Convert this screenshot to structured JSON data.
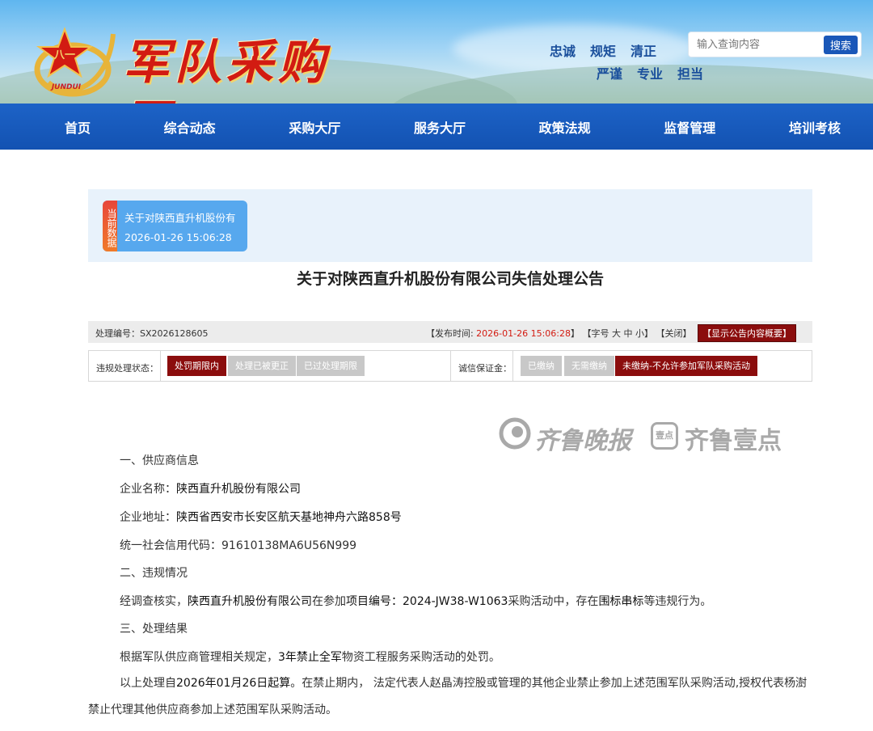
{
  "header": {
    "site_name": "军队采购网",
    "emblem_text": "八一",
    "emblem_sub": "JUNDUI",
    "slogans_row1": [
      "忠诚",
      "规矩",
      "清正"
    ],
    "slogans_row2": [
      "严谨",
      "专业",
      "担当"
    ],
    "search": {
      "placeholder": "输入查询内容",
      "button": "搜索"
    }
  },
  "nav": [
    "首页",
    "综合动态",
    "采购大厅",
    "服务大厅",
    "政策法规",
    "监督管理",
    "培训考核"
  ],
  "current": {
    "tag": "当前数据",
    "title": "关于对陕西直升机股份有",
    "time": "2026-01-26 15:06:28"
  },
  "notice_title": "关于对陕西直升机股份有限公司失信处理公告",
  "meta": {
    "number_label": "处理编号：",
    "number": "SX2026128605",
    "publish_prefix": "【发布时间: ",
    "publish_date": "2026-01-26 15:06:28",
    "publish_suffix": "】",
    "font_prefix": "【字号",
    "font_large": "大",
    "font_medium": "中",
    "font_small": "小",
    "font_suffix": "】",
    "close": "【关闭】",
    "summary": "【显示公告内容概要】"
  },
  "status": {
    "label": "违规处理状态：",
    "options": [
      "处罚期限内",
      "处理已被更正",
      "已过处理期限"
    ],
    "active_index": 0,
    "deposit_label": "诚信保证金：",
    "deposit_options": [
      "已缴纳",
      "无需缴纳",
      "未缴纳-不允许参加军队采购活动"
    ],
    "deposit_active_index": 2
  },
  "watermark": {
    "brand1": "齐鲁晚报",
    "badge": "壹点",
    "brand2": "齐鲁壹点"
  },
  "content": {
    "sec1": "一、供应商信息",
    "name_label": "企业名称：",
    "name": "陕西直升机股份有限公司",
    "addr_label": "企业地址：",
    "addr": "陕西省西安市长安区航天基地神舟六路858号",
    "credit_label": "统一社会信用代码：",
    "credit": "91610138MA6U56N999",
    "sec2": "二、违规情况",
    "v_pre": "经调查核实，",
    "v_company": "陕西直升机股份有限公司",
    "v_mid1": "在参加",
    "v_proj_label": "项目编号：",
    "v_proj": "2024-JW38-W1063",
    "v_mid2": "采购活动中，存在",
    "v_kind": "围标串标",
    "v_end": "等违规行为。",
    "sec3": "三、处理结果",
    "r_pre": "根据军队供应商管理相关规定，",
    "r_years": "3年禁止全军",
    "r_end": "物资工程服务采购活动的处罚。",
    "f_pre": "以上处理自",
    "f_date": "2026年01月26日起算",
    "f_rest": "。在禁止期内， 法定代表人赵晶涛控股或管理的其他企业禁止参加上述范围军队采购活动,授权代表杨澍禁止代理其他供应商参加上述范围军队采购活动。"
  }
}
